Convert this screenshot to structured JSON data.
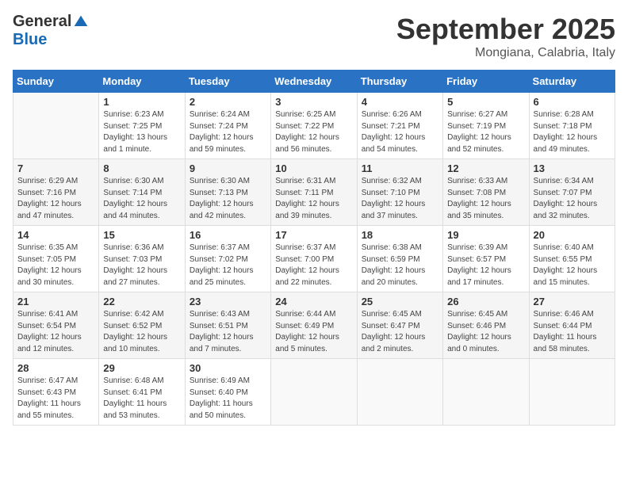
{
  "logo": {
    "general": "General",
    "blue": "Blue"
  },
  "title": "September 2025",
  "location": "Mongiana, Calabria, Italy",
  "weekdays": [
    "Sunday",
    "Monday",
    "Tuesday",
    "Wednesday",
    "Thursday",
    "Friday",
    "Saturday"
  ],
  "weeks": [
    [
      {
        "day": "",
        "info": ""
      },
      {
        "day": "1",
        "info": "Sunrise: 6:23 AM\nSunset: 7:25 PM\nDaylight: 13 hours\nand 1 minute."
      },
      {
        "day": "2",
        "info": "Sunrise: 6:24 AM\nSunset: 7:24 PM\nDaylight: 12 hours\nand 59 minutes."
      },
      {
        "day": "3",
        "info": "Sunrise: 6:25 AM\nSunset: 7:22 PM\nDaylight: 12 hours\nand 56 minutes."
      },
      {
        "day": "4",
        "info": "Sunrise: 6:26 AM\nSunset: 7:21 PM\nDaylight: 12 hours\nand 54 minutes."
      },
      {
        "day": "5",
        "info": "Sunrise: 6:27 AM\nSunset: 7:19 PM\nDaylight: 12 hours\nand 52 minutes."
      },
      {
        "day": "6",
        "info": "Sunrise: 6:28 AM\nSunset: 7:18 PM\nDaylight: 12 hours\nand 49 minutes."
      }
    ],
    [
      {
        "day": "7",
        "info": "Sunrise: 6:29 AM\nSunset: 7:16 PM\nDaylight: 12 hours\nand 47 minutes."
      },
      {
        "day": "8",
        "info": "Sunrise: 6:30 AM\nSunset: 7:14 PM\nDaylight: 12 hours\nand 44 minutes."
      },
      {
        "day": "9",
        "info": "Sunrise: 6:30 AM\nSunset: 7:13 PM\nDaylight: 12 hours\nand 42 minutes."
      },
      {
        "day": "10",
        "info": "Sunrise: 6:31 AM\nSunset: 7:11 PM\nDaylight: 12 hours\nand 39 minutes."
      },
      {
        "day": "11",
        "info": "Sunrise: 6:32 AM\nSunset: 7:10 PM\nDaylight: 12 hours\nand 37 minutes."
      },
      {
        "day": "12",
        "info": "Sunrise: 6:33 AM\nSunset: 7:08 PM\nDaylight: 12 hours\nand 35 minutes."
      },
      {
        "day": "13",
        "info": "Sunrise: 6:34 AM\nSunset: 7:07 PM\nDaylight: 12 hours\nand 32 minutes."
      }
    ],
    [
      {
        "day": "14",
        "info": "Sunrise: 6:35 AM\nSunset: 7:05 PM\nDaylight: 12 hours\nand 30 minutes."
      },
      {
        "day": "15",
        "info": "Sunrise: 6:36 AM\nSunset: 7:03 PM\nDaylight: 12 hours\nand 27 minutes."
      },
      {
        "day": "16",
        "info": "Sunrise: 6:37 AM\nSunset: 7:02 PM\nDaylight: 12 hours\nand 25 minutes."
      },
      {
        "day": "17",
        "info": "Sunrise: 6:37 AM\nSunset: 7:00 PM\nDaylight: 12 hours\nand 22 minutes."
      },
      {
        "day": "18",
        "info": "Sunrise: 6:38 AM\nSunset: 6:59 PM\nDaylight: 12 hours\nand 20 minutes."
      },
      {
        "day": "19",
        "info": "Sunrise: 6:39 AM\nSunset: 6:57 PM\nDaylight: 12 hours\nand 17 minutes."
      },
      {
        "day": "20",
        "info": "Sunrise: 6:40 AM\nSunset: 6:55 PM\nDaylight: 12 hours\nand 15 minutes."
      }
    ],
    [
      {
        "day": "21",
        "info": "Sunrise: 6:41 AM\nSunset: 6:54 PM\nDaylight: 12 hours\nand 12 minutes."
      },
      {
        "day": "22",
        "info": "Sunrise: 6:42 AM\nSunset: 6:52 PM\nDaylight: 12 hours\nand 10 minutes."
      },
      {
        "day": "23",
        "info": "Sunrise: 6:43 AM\nSunset: 6:51 PM\nDaylight: 12 hours\nand 7 minutes."
      },
      {
        "day": "24",
        "info": "Sunrise: 6:44 AM\nSunset: 6:49 PM\nDaylight: 12 hours\nand 5 minutes."
      },
      {
        "day": "25",
        "info": "Sunrise: 6:45 AM\nSunset: 6:47 PM\nDaylight: 12 hours\nand 2 minutes."
      },
      {
        "day": "26",
        "info": "Sunrise: 6:45 AM\nSunset: 6:46 PM\nDaylight: 12 hours\nand 0 minutes."
      },
      {
        "day": "27",
        "info": "Sunrise: 6:46 AM\nSunset: 6:44 PM\nDaylight: 11 hours\nand 58 minutes."
      }
    ],
    [
      {
        "day": "28",
        "info": "Sunrise: 6:47 AM\nSunset: 6:43 PM\nDaylight: 11 hours\nand 55 minutes."
      },
      {
        "day": "29",
        "info": "Sunrise: 6:48 AM\nSunset: 6:41 PM\nDaylight: 11 hours\nand 53 minutes."
      },
      {
        "day": "30",
        "info": "Sunrise: 6:49 AM\nSunset: 6:40 PM\nDaylight: 11 hours\nand 50 minutes."
      },
      {
        "day": "",
        "info": ""
      },
      {
        "day": "",
        "info": ""
      },
      {
        "day": "",
        "info": ""
      },
      {
        "day": "",
        "info": ""
      }
    ]
  ]
}
